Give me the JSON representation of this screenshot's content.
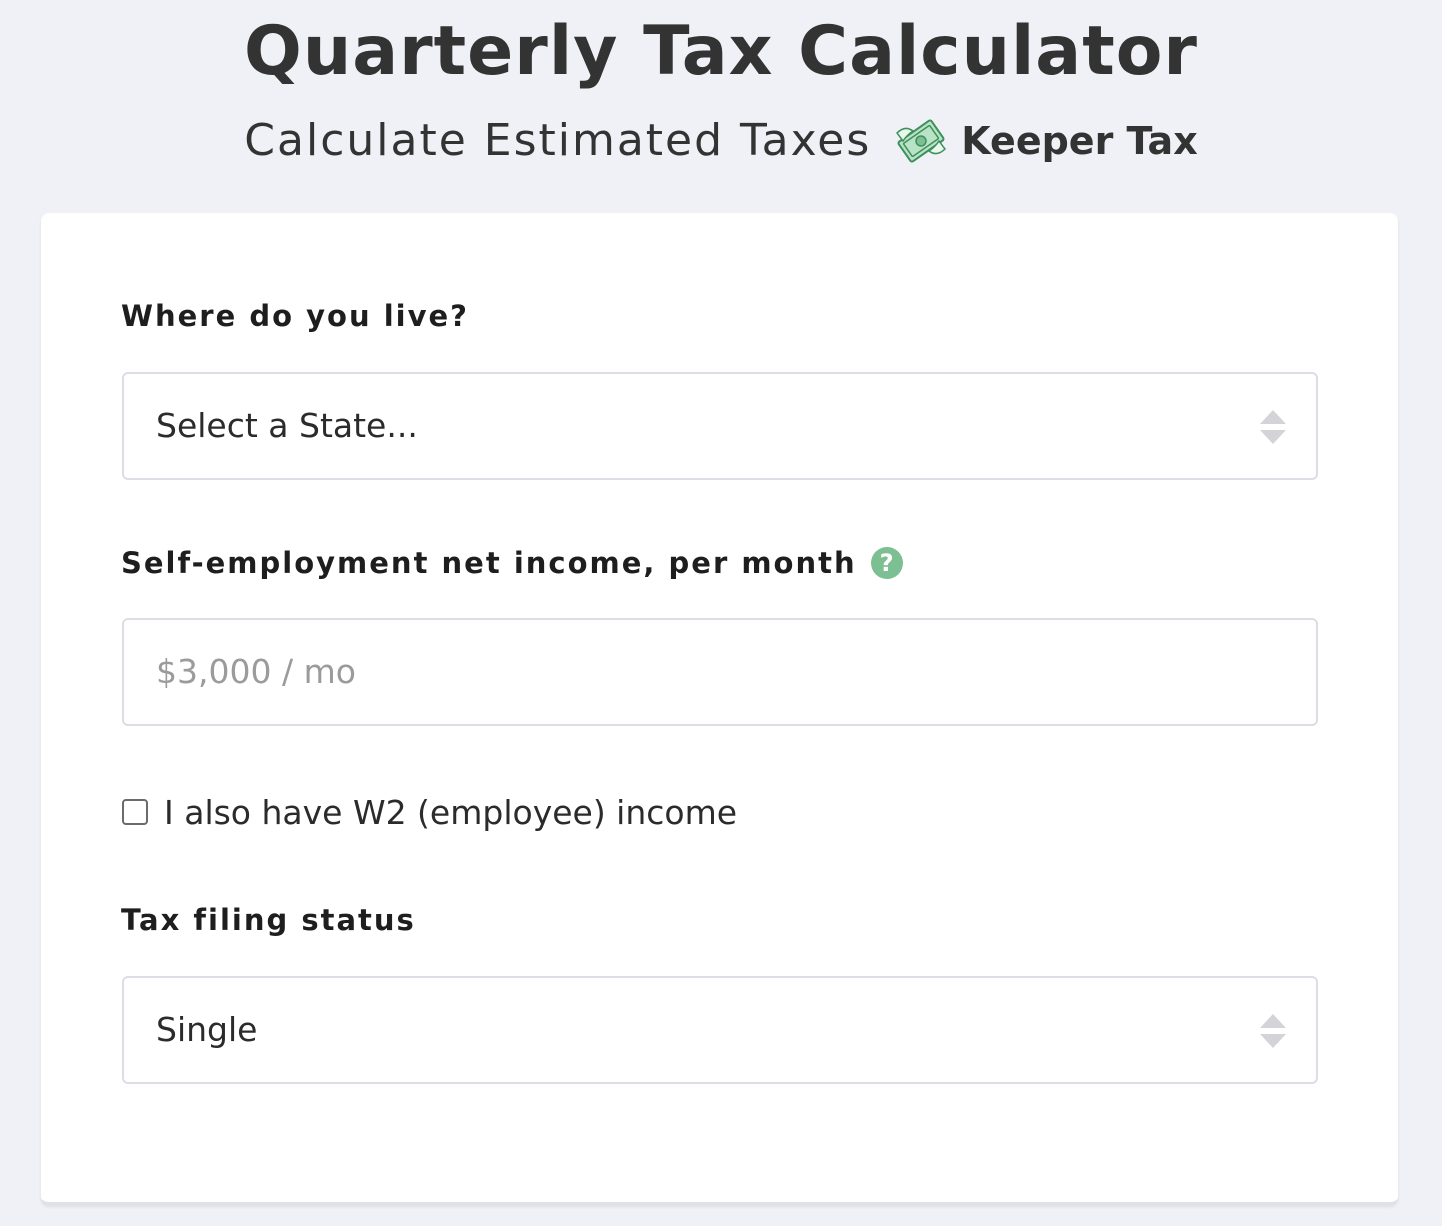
{
  "header": {
    "title": "Quarterly Tax Calculator",
    "subtitle": "Calculate Estimated Taxes",
    "brand": "Keeper Tax",
    "logo_icon": "flying-money-icon",
    "accent_color": "#7cbf93"
  },
  "form": {
    "state": {
      "label": "Where do you live?",
      "selected": "Select a State..."
    },
    "income": {
      "label": "Self-employment net income, per month",
      "help_icon": "question-mark-icon",
      "help_glyph": "?",
      "placeholder": "$3,000 / mo",
      "value": ""
    },
    "w2": {
      "label": "I also have W2 (employee) income",
      "checked": false
    },
    "filing_status": {
      "label": "Tax filing status",
      "selected": "Single"
    }
  }
}
